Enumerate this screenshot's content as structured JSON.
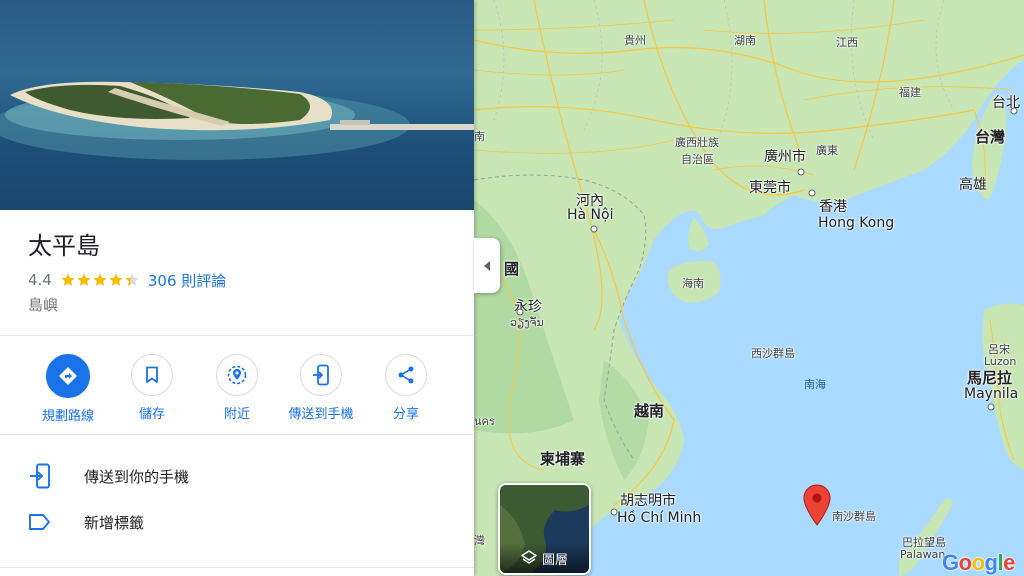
{
  "place": {
    "title": "太平島",
    "rating": "4.4",
    "stars": 4.4,
    "reviews": "306 則評論",
    "category": "島嶼"
  },
  "actions": [
    {
      "label": "規劃路線",
      "icon": "directions-icon"
    },
    {
      "label": "儲存",
      "icon": "bookmark-icon"
    },
    {
      "label": "附近",
      "icon": "nearby-icon"
    },
    {
      "label": "傳送到手機",
      "icon": "send-to-phone-icon"
    },
    {
      "label": "分享",
      "icon": "share-icon"
    }
  ],
  "list": [
    {
      "label": "傳送到你的手機",
      "icon": "send-to-phone-icon"
    },
    {
      "label": "新增標籤",
      "icon": "label-icon"
    }
  ],
  "map": {
    "labels": {
      "guizhou": "貴州",
      "hunan": "湖南",
      "jiangxi": "江西",
      "fujian": "福建",
      "taibei": "台北",
      "taiwan": "台灣",
      "gaoxiong": "高雄",
      "guangxi": "廣西壯族",
      "guangxi2": "自治區",
      "guangzhou": "廣州市",
      "guangdong": "廣東",
      "dongguan": "東莞市",
      "hongkong_zh": "香港",
      "hongkong_en": "Hong Kong",
      "hanoi_zh": "河內",
      "hanoi_en": "Hà Nội",
      "hainan": "海南",
      "guo": "國",
      "vientiane_zh": "永珍",
      "vientiane_lao": "ວຽງຈັນ",
      "xisha": "西沙群島",
      "nanhai": "南海",
      "vietnam": "越南",
      "nkhon": "นคร",
      "cambodia": "柬埔寨",
      "hcm_zh": "胡志明市",
      "hcm_en": "Hồ Chí Minh",
      "nansha": "南沙群島",
      "luzon_zh": "呂宋",
      "luzon_en": "Luzon",
      "manila_zh": "馬尼拉",
      "manila_en": "Maynila",
      "palawan_zh": "巴拉望島",
      "palawan_en": "Palawan",
      "wan": "灣",
      "nan_left": "南"
    },
    "layers_label": "圖層",
    "google_logo": "Google"
  },
  "colors": {
    "accent": "#1a73e8",
    "star": "#fbbc04",
    "pin": "#ea4335",
    "water": "#aadaff",
    "land": "#c7e6b4"
  }
}
